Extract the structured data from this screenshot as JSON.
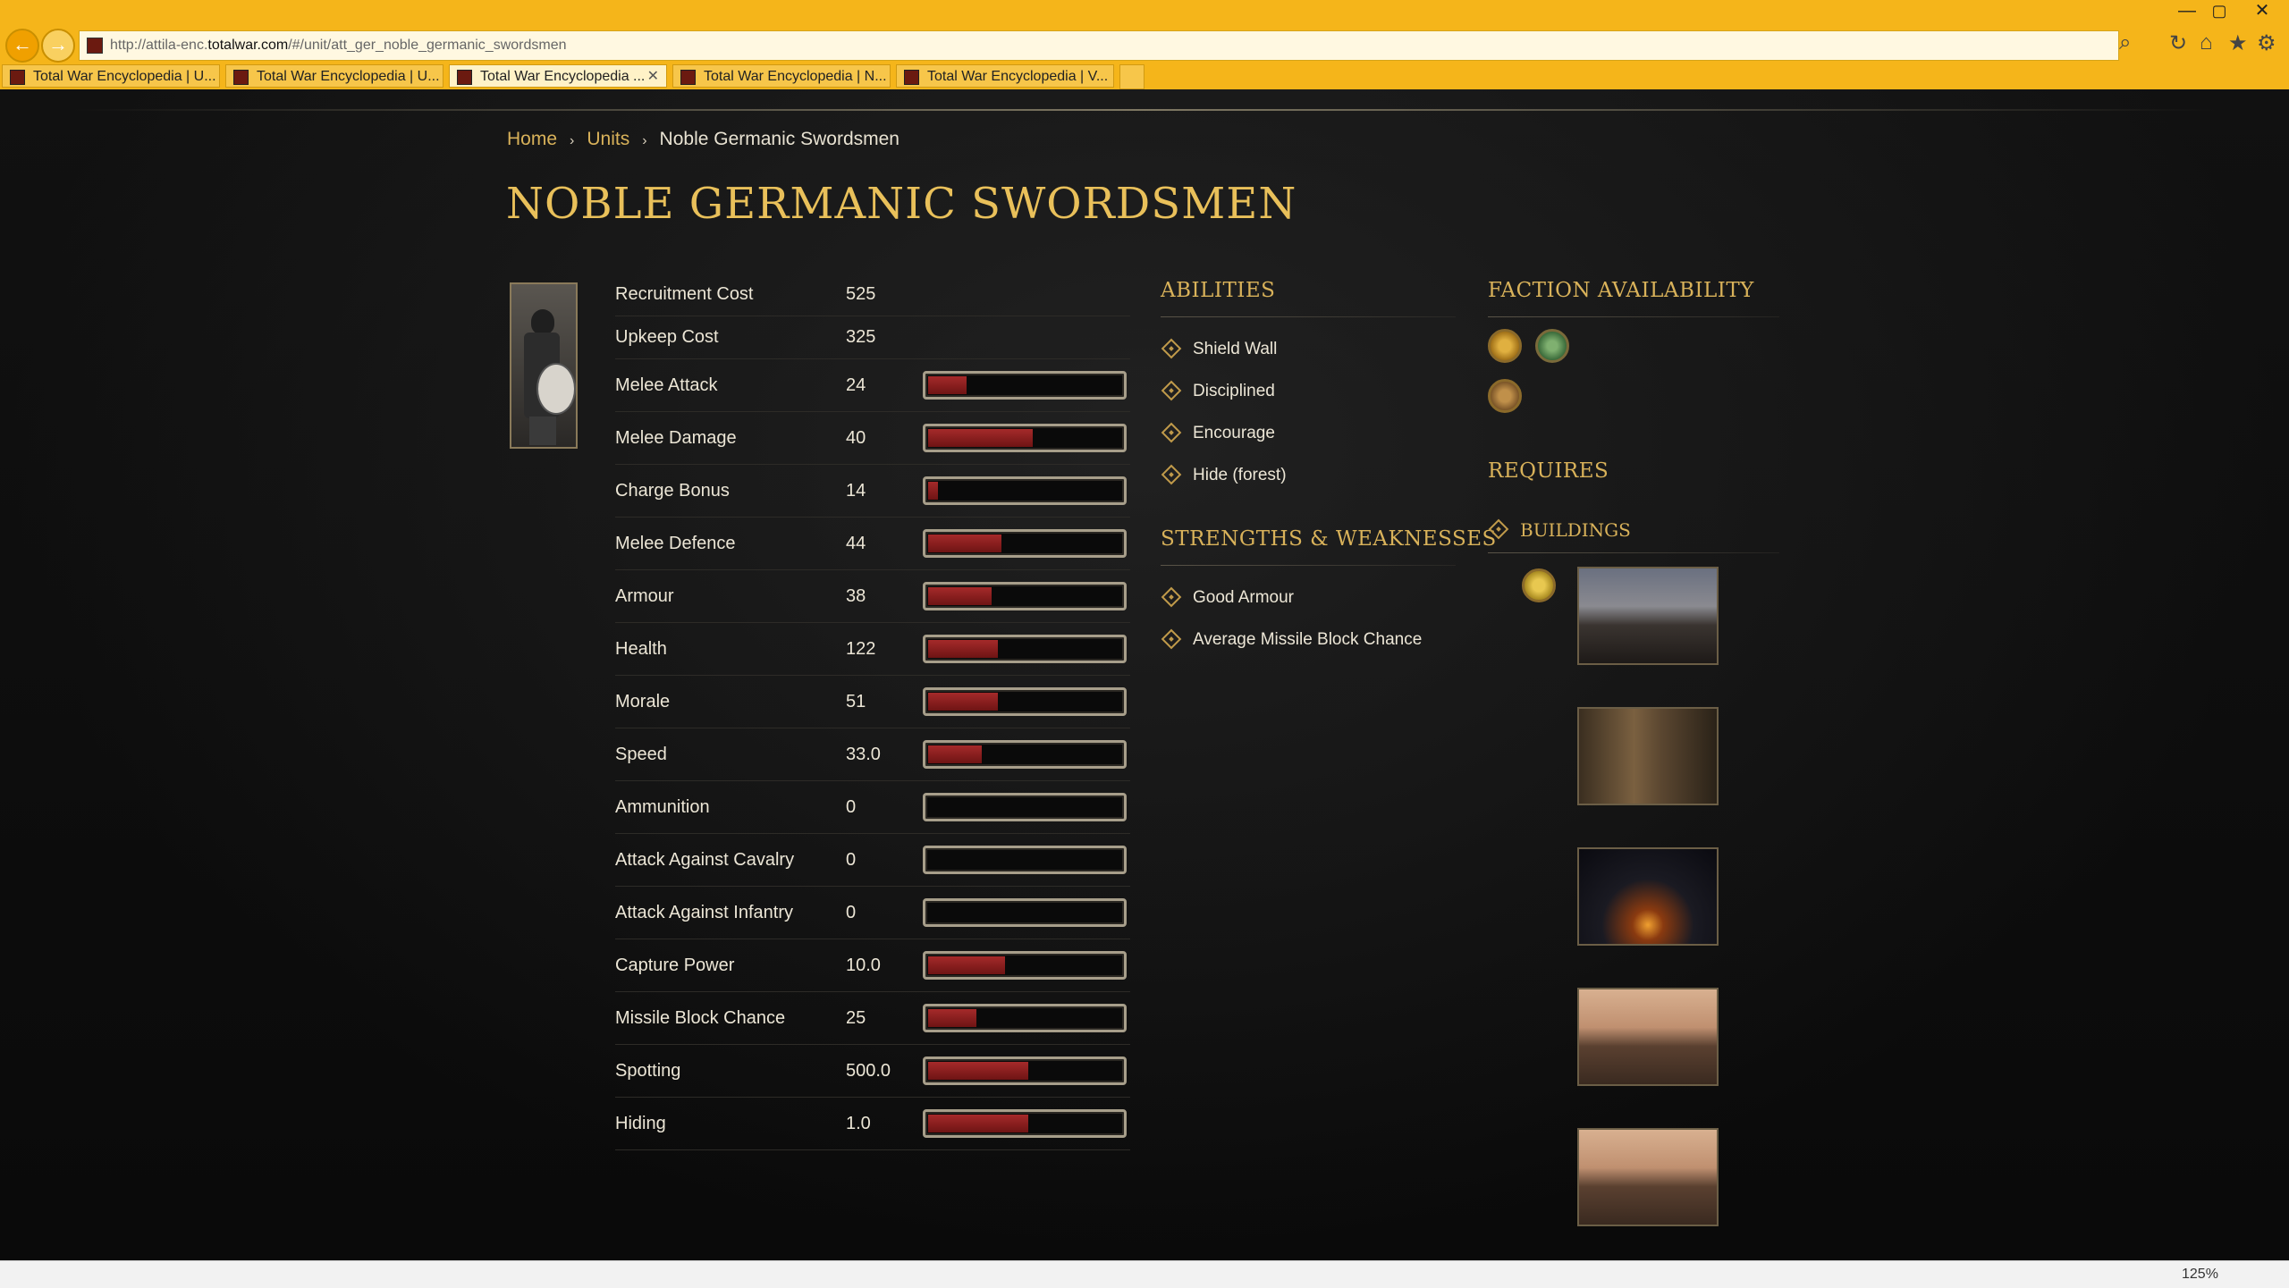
{
  "browser": {
    "window_controls": {
      "minimize": "—",
      "maximize": "▢",
      "close": "✕"
    },
    "nav_back": "←",
    "nav_forward": "→",
    "url_prefix": "http://attila-enc.",
    "url_domain": "totalwar.com",
    "url_suffix": "/#/unit/att_ger_noble_germanic_swordsmen",
    "tools": {
      "search": "⌕",
      "refresh": "↻",
      "home": "⌂",
      "favorites": "★",
      "settings": "⚙"
    },
    "tabs": [
      {
        "label": "Total War Encyclopedia | U..."
      },
      {
        "label": "Total War Encyclopedia | U..."
      },
      {
        "label": "Total War Encyclopedia ...",
        "active": true,
        "close": "✕"
      },
      {
        "label": "Total War Encyclopedia | N..."
      },
      {
        "label": "Total War Encyclopedia | V..."
      }
    ],
    "zoom": "125%"
  },
  "breadcrumb": {
    "home": "Home",
    "units": "Units",
    "current": "Noble Germanic Swordsmen",
    "separator": "›"
  },
  "page_title": "NOBLE GERMANIC SWORDSMEN",
  "stats": [
    {
      "label": "Recruitment Cost",
      "value": "525"
    },
    {
      "label": "Upkeep Cost",
      "value": "325"
    },
    {
      "label": "Melee Attack",
      "value": "24",
      "fill": 0.2
    },
    {
      "label": "Melee Damage",
      "value": "40",
      "fill": 0.54
    },
    {
      "label": "Charge Bonus",
      "value": "14",
      "fill": 0.05
    },
    {
      "label": "Melee Defence",
      "value": "44",
      "fill": 0.38
    },
    {
      "label": "Armour",
      "value": "38",
      "fill": 0.33
    },
    {
      "label": "Health",
      "value": "122",
      "fill": 0.36
    },
    {
      "label": "Morale",
      "value": "51",
      "fill": 0.36
    },
    {
      "label": "Speed",
      "value": "33.0",
      "fill": 0.28
    },
    {
      "label": "Ammunition",
      "value": "0",
      "fill": 0
    },
    {
      "label": "Attack Against Cavalry",
      "value": "0",
      "fill": 0
    },
    {
      "label": "Attack Against Infantry",
      "value": "0",
      "fill": 0
    },
    {
      "label": "Capture Power",
      "value": "10.0",
      "fill": 0.4
    },
    {
      "label": "Missile Block Chance",
      "value": "25",
      "fill": 0.25
    },
    {
      "label": "Spotting",
      "value": "500.0",
      "fill": 0.52
    },
    {
      "label": "Hiding",
      "value": "1.0",
      "fill": 0.52
    }
  ],
  "abilities": {
    "title": "ABILITIES",
    "items": [
      "Shield Wall",
      "Disciplined",
      "Encourage",
      "Hide (forest)"
    ]
  },
  "strengths": {
    "title": "STRENGTHS & WEAKNESSES",
    "items": [
      "Good Armour",
      "Average Missile Block Chance"
    ]
  },
  "faction_availability": {
    "title": "FACTION AVAILABILITY"
  },
  "requires": {
    "title": "REQUIRES",
    "buildings_title": "BUILDINGS"
  },
  "colors": {
    "accent": "#d9b25a",
    "chrome": "#f5b51a",
    "bar_fill": "#a52a2a"
  }
}
